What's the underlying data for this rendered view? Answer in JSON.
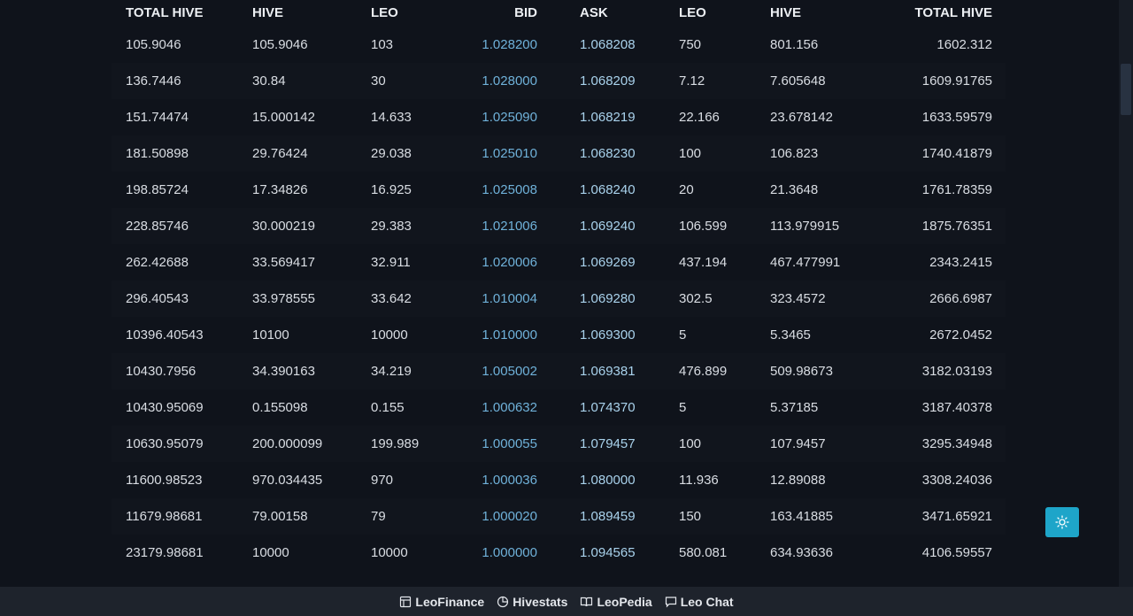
{
  "table": {
    "headers": [
      "TOTAL HIVE",
      "HIVE",
      "LEO",
      "BID",
      "ASK",
      "LEO",
      "HIVE",
      "TOTAL HIVE"
    ],
    "rows": [
      [
        "105.9046",
        "105.9046",
        "103",
        "1.028200",
        "1.068208",
        "750",
        "801.156",
        "1602.312"
      ],
      [
        "136.7446",
        "30.84",
        "30",
        "1.028000",
        "1.068209",
        "7.12",
        "7.605648",
        "1609.91765"
      ],
      [
        "151.74474",
        "15.000142",
        "14.633",
        "1.025090",
        "1.068219",
        "22.166",
        "23.678142",
        "1633.59579"
      ],
      [
        "181.50898",
        "29.76424",
        "29.038",
        "1.025010",
        "1.068230",
        "100",
        "106.823",
        "1740.41879"
      ],
      [
        "198.85724",
        "17.34826",
        "16.925",
        "1.025008",
        "1.068240",
        "20",
        "21.3648",
        "1761.78359"
      ],
      [
        "228.85746",
        "30.000219",
        "29.383",
        "1.021006",
        "1.069240",
        "106.599",
        "113.979915",
        "1875.76351"
      ],
      [
        "262.42688",
        "33.569417",
        "32.911",
        "1.020006",
        "1.069269",
        "437.194",
        "467.477991",
        "2343.2415"
      ],
      [
        "296.40543",
        "33.978555",
        "33.642",
        "1.010004",
        "1.069280",
        "302.5",
        "323.4572",
        "2666.6987"
      ],
      [
        "10396.40543",
        "10100",
        "10000",
        "1.010000",
        "1.069300",
        "5",
        "5.3465",
        "2672.0452"
      ],
      [
        "10430.7956",
        "34.390163",
        "34.219",
        "1.005002",
        "1.069381",
        "476.899",
        "509.98673",
        "3182.03193"
      ],
      [
        "10430.95069",
        "0.155098",
        "0.155",
        "1.000632",
        "1.074370",
        "5",
        "5.37185",
        "3187.40378"
      ],
      [
        "10630.95079",
        "200.000099",
        "199.989",
        "1.000055",
        "1.079457",
        "100",
        "107.9457",
        "3295.34948"
      ],
      [
        "11600.98523",
        "970.034435",
        "970",
        "1.000036",
        "1.080000",
        "11.936",
        "12.89088",
        "3308.24036"
      ],
      [
        "11679.98681",
        "79.00158",
        "79",
        "1.000020",
        "1.089459",
        "150",
        "163.41885",
        "3471.65921"
      ],
      [
        "23179.98681",
        "10000",
        "10000",
        "1.000000",
        "1.094565",
        "580.081",
        "634.93636",
        "4106.59557"
      ]
    ]
  },
  "footer": {
    "links": [
      {
        "label": "LeoFinance",
        "icon": "newspaper-icon"
      },
      {
        "label": "Hivestats",
        "icon": "pie-chart-icon"
      },
      {
        "label": "LeoPedia",
        "icon": "book-icon"
      },
      {
        "label": "Leo Chat",
        "icon": "chat-icon"
      }
    ]
  },
  "theme_toggle": {
    "icon": "sun-icon",
    "color": "#1ea5c9"
  },
  "colors": {
    "background": "#0f131b",
    "bid": "#6fb1d9",
    "ask": "#a9d2ec",
    "footer": "#1e232c"
  }
}
